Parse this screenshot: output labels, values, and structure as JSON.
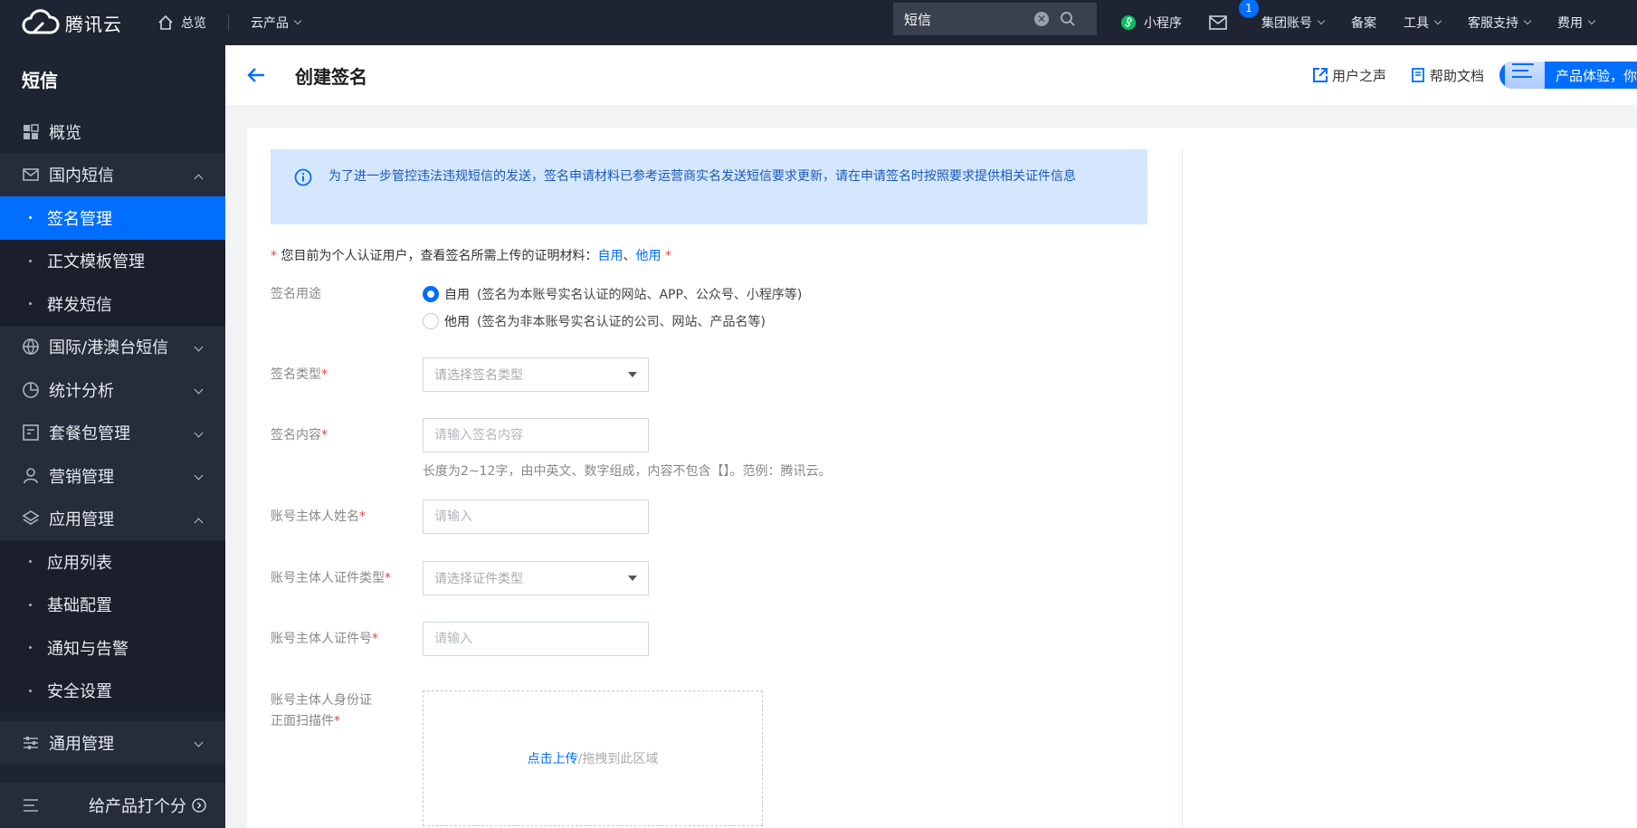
{
  "topbar": {
    "logo_text": "腾讯云",
    "overview": "总览",
    "products": "云产品",
    "search_value": "短信",
    "mini_program": "小程序",
    "mail_badge": "1",
    "group_account": "集团账号",
    "filing": "备案",
    "tools": "工具",
    "support": "客服支持",
    "billing": "费用"
  },
  "sidebar": {
    "title": "短信",
    "items": [
      {
        "label": "概览"
      },
      {
        "label": "国内短信"
      },
      {
        "label": "签名管理"
      },
      {
        "label": "正文模板管理"
      },
      {
        "label": "群发短信"
      },
      {
        "label": "国际/港澳台短信"
      },
      {
        "label": "统计分析"
      },
      {
        "label": "套餐包管理"
      },
      {
        "label": "营销管理"
      },
      {
        "label": "应用管理"
      },
      {
        "label": "应用列表"
      },
      {
        "label": "基础配置"
      },
      {
        "label": "通知与告警"
      },
      {
        "label": "安全设置"
      },
      {
        "label": "通用管理"
      }
    ],
    "rate_label": "给产品打个分"
  },
  "header": {
    "title": "创建签名",
    "user_voice": "用户之声",
    "help_doc": "帮助文档",
    "experience": "产品体验，你说了算"
  },
  "notice": "为了进一步管控违法违规短信的发送，签名申请材料已参考运营商实名发送短信要求更新，请在申请签名时按照要求提供相关证件信息",
  "hint": {
    "prefix": "您目前为个人认证用户，查看签名所需上传的证明材料：",
    "link1": "自用",
    "sep": "、",
    "link2": "他用"
  },
  "form": {
    "usage_label": "签名用途",
    "usage_options": [
      {
        "label": "自用",
        "desc": "(签名为本账号实名认证的网站、APP、公众号、小程序等)"
      },
      {
        "label": "他用",
        "desc": "(签名为非本账号实名认证的公司、网站、产品名等)"
      }
    ],
    "usage_selected": "自用",
    "type_label": "签名类型",
    "type_placeholder": "请选择签名类型",
    "content_label": "签名内容",
    "content_placeholder": "请输入签名内容",
    "content_help": "长度为2~12字，由中英文、数字组成，内容不包含【】。范例：腾讯云。",
    "owner_name_label": "账号主体人姓名",
    "owner_name_placeholder": "请输入",
    "id_type_label": "账号主体人证件类型",
    "id_type_placeholder": "请选择证件类型",
    "id_no_label": "账号主体人证件号",
    "id_no_placeholder": "请输入",
    "id_scan_label_1": "账号主体人身份证",
    "id_scan_label_2": "正面扫描件",
    "upload_link": "点击上传",
    "upload_text": "/拖拽到此区域"
  },
  "colors": {
    "topbar_bg": "#1e2431",
    "accent": "#006eff",
    "notice_bg": "#d5e7ff",
    "required": "#e54545"
  }
}
